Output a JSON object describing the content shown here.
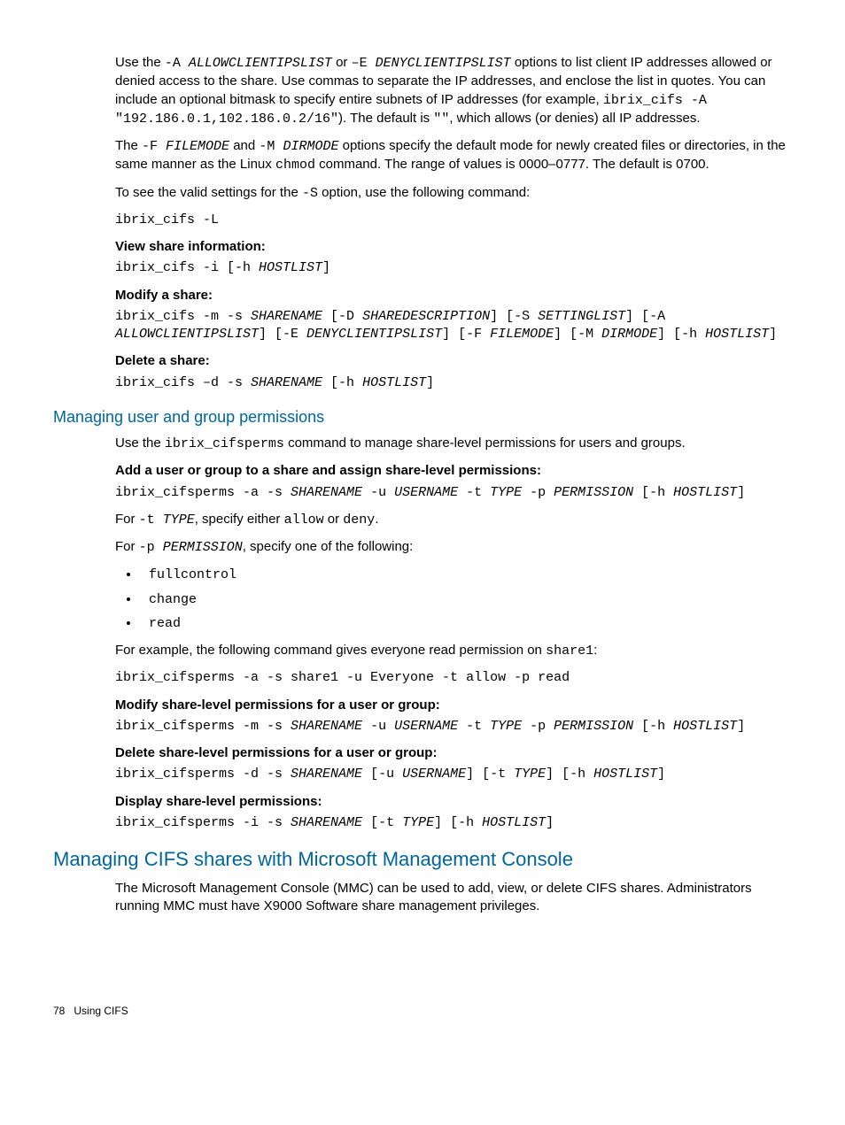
{
  "p1": {
    "pre": "Use the ",
    "code1": "-A ",
    "ital1": "ALLOWCLIENTIPSLIST",
    "mid1": " or ",
    "code2": "–E ",
    "ital2": "DENYCLIENTIPSLIST",
    "mid2": " options to list client IP addresses allowed or denied access to the share. Use commas to separate the IP addresses, and enclose the list in quotes. You can include an optional bitmask to specify entire subnets of IP addresses (for example, ",
    "code3": "ibrix_cifs -A \"192.186.0.1,102.186.0.2/16\"",
    "mid3": "). The default is ",
    "code4": "\"\"",
    "tail": ", which allows (or denies) all IP addresses."
  },
  "p2": {
    "pre": "The ",
    "code1": "-F ",
    "ital1": "FILEMODE",
    "mid1": " and ",
    "code2": "-M ",
    "ital2": "DIRMODE",
    "mid2": " options specify the default mode for newly created files or directories, in the same manner as the Linux ",
    "code3": "chmod",
    "tail": " command. The range of values is 0000–0777. The default is 0700."
  },
  "p3": {
    "pre": "To see the valid settings for the ",
    "code1": "-S",
    "tail": " option, use the following command:"
  },
  "cmd1": "ibrix_cifs -L",
  "h_view": "View share information:",
  "cmd2": {
    "pre": "ibrix_cifs -i [-h ",
    "i1": "HOSTLIST",
    "t": "]"
  },
  "h_modify": "Modify a share:",
  "cmd3": {
    "pre": "ibrix_cifs -m -s ",
    "i1": "SHARENAME",
    "s1": " [-D ",
    "i2": "SHAREDESCRIPTION",
    "s2": "] [-S ",
    "i3": "SETTINGLIST",
    "s3": "] [-A ",
    "i4": "ALLOWCLIENTIPSLIST",
    "s4": "] [-E ",
    "i5": "DENYCLIENTIPSLIST",
    "s5": "] [-F ",
    "i6": "FILEMODE",
    "s6": "] [-M ",
    "i7": "DIRMODE",
    "s7": "] [-h ",
    "i8": "HOSTLIST",
    "t": "]"
  },
  "h_delete": "Delete a share:",
  "cmd4": {
    "pre": "ibrix_cifs –d -s ",
    "i1": "SHARENAME",
    "s1": " [-h ",
    "i2": "HOSTLIST",
    "t": "]"
  },
  "sec1": "Managing user and group permissions",
  "p4": {
    "pre": "Use the ",
    "code1": "ibrix_cifsperms",
    "tail": " command to manage share-level permissions for users and groups."
  },
  "h_add": "Add a user or group to a share and assign share-level permissions:",
  "cmd5": {
    "pre": "ibrix_cifsperms -a -s ",
    "i1": "SHARENAME",
    "s1": " -u ",
    "i2": "USERNAME",
    "s2": " -t ",
    "i3": "TYPE",
    "s3": " -p ",
    "i4": "PERMISSION",
    "s4": " [-h ",
    "i5": "HOSTLIST",
    "t": "]"
  },
  "p5": {
    "pre": "For ",
    "c1": "-t ",
    "i1": "TYPE",
    "mid": ", specify either ",
    "c2": "allow",
    "mid2": " or ",
    "c3": "deny",
    "t": "."
  },
  "p6": {
    "pre": "For ",
    "c1": "-p ",
    "i1": "PERMISSION",
    "t": ", specify one of the following:"
  },
  "list": [
    "fullcontrol",
    "change",
    "read"
  ],
  "p7": {
    "pre": "For example, the following command gives everyone read permission on ",
    "c1": "share1",
    "t": ":"
  },
  "cmd6": "ibrix_cifsperms -a -s share1 -u Everyone -t allow -p read",
  "h_modperm": "Modify share-level permissions for a user or group:",
  "cmd7": {
    "pre": "ibrix_cifsperms -m -s ",
    "i1": "SHARENAME",
    "s1": " -u ",
    "i2": "USERNAME",
    "s2": " -t ",
    "i3": "TYPE",
    "s3": " -p ",
    "i4": "PERMISSION",
    "s4": " [-h ",
    "i5": "HOSTLIST",
    "t": "]"
  },
  "h_delperm": "Delete share-level permissions for a user or group:",
  "cmd8": {
    "pre": "ibrix_cifsperms -d -s ",
    "i1": "SHARENAME",
    "s1": " [-u ",
    "i2": "USERNAME",
    "s2": "] [-t ",
    "i3": "TYPE",
    "s3": "] [-h ",
    "i4": "HOSTLIST",
    "t": "]"
  },
  "h_dispperm": "Display share-level permissions:",
  "cmd9": {
    "pre": "ibrix_cifsperms -i -s ",
    "i1": "SHARENAME",
    "s1": " [-t ",
    "i2": "TYPE",
    "s2": "] [-h ",
    "i3": "HOSTLIST",
    "t": "]"
  },
  "sec2": "Managing CIFS shares with Microsoft Management Console",
  "p8": "The Microsoft Management Console (MMC) can be used to add, view, or delete CIFS shares. Administrators running MMC must have X9000 Software share management privileges.",
  "footer": {
    "page": "78",
    "title": "Using CIFS"
  }
}
